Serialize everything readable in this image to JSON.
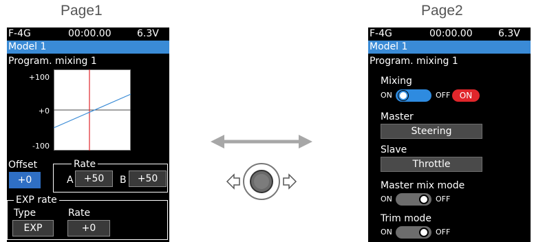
{
  "labels": {
    "page1": "Page1",
    "page2": "Page2"
  },
  "header": {
    "model": "F-4G",
    "timer": "00:00.00",
    "voltage": "6.3V",
    "model_name": "Model 1",
    "function_title": "Program. mixing 1"
  },
  "page1": {
    "graph": {
      "y_max": "+100",
      "y_mid": "+0",
      "y_min": "-100"
    },
    "offset": {
      "label": "Offset",
      "value": "+0"
    },
    "rate": {
      "title": "Rate",
      "a_label": "A",
      "a_value": "+50",
      "b_label": "B",
      "b_value": "+50"
    },
    "exp": {
      "title": "EXP rate",
      "type_label": "Type",
      "type_value": "EXP",
      "rate_label": "Rate",
      "rate_value": "+0"
    }
  },
  "page2": {
    "mixing": {
      "label": "Mixing",
      "on": "ON",
      "off": "OFF",
      "state": "ON"
    },
    "master": {
      "label": "Master",
      "value": "Steering"
    },
    "slave": {
      "label": "Slave",
      "value": "Throttle"
    },
    "master_mix_mode": {
      "label": "Master mix mode",
      "on": "ON",
      "off": "OFF"
    },
    "trim_mode": {
      "label": "Trim mode",
      "on": "ON",
      "off": "OFF"
    }
  },
  "colors": {
    "accent_blue": "#3a8bd6",
    "on_red": "#e0262b",
    "curve": "#3a8bd6",
    "center_line": "#e0262b"
  }
}
